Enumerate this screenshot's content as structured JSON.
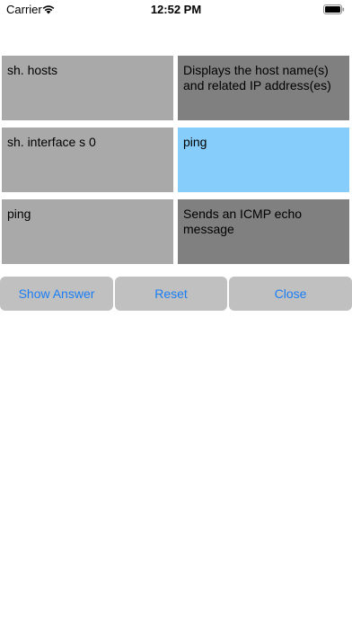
{
  "status": {
    "carrier": "Carrier",
    "time": "12:52 PM",
    "wifi_icon": "wifi-icon",
    "battery_icon": "battery-icon"
  },
  "grid": {
    "rows": [
      {
        "left": "sh. hosts",
        "right": "Displays the host name(s) and related IP address(es)"
      },
      {
        "left": "sh. interface s 0",
        "right": "ping"
      },
      {
        "left": "ping",
        "right": "Sends an ICMP echo message"
      }
    ],
    "selected_color": "#86cdfb",
    "left_color": "#a9a9a9",
    "right_color": "#808080"
  },
  "buttons": {
    "show_answer": "Show Answer",
    "reset": "Reset",
    "close": "Close",
    "label_color": "#1a7ef5"
  }
}
